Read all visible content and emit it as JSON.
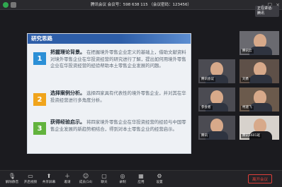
{
  "window": {
    "title": "腾讯会议  会议号：598 638 115 （会议密码：123456）",
    "speaking_label": "正在讲话: 腾讯"
  },
  "share": {
    "label": ""
  },
  "slide": {
    "header": "研究思路",
    "points": [
      {
        "num": "1",
        "title": "把握理论背景。",
        "text": "在把握境外零售企业定义的基础上，借助文献资料对境外零售企业在华投资经营的研究进行了解，提出如何用境外零售企业在华投资经营的经验帮助本土零售企业发展的问题。"
      },
      {
        "num": "2",
        "title": "选择案例分析。",
        "text": "选择四家具有代表性的境外零售企业，并对其在华投资经营进行多角度分析。"
      },
      {
        "num": "3",
        "title": "获得经验启示。",
        "text": "将四家境外零售企业在华投资经营的经验与中国零售企业发展的新趋势相结合，得到对本土零售企业的经营启示。"
      }
    ]
  },
  "participants": [
    {
      "name": "腾讯云"
    },
    {
      "name": "腾讯会议"
    },
    {
      "name": "刘勇"
    },
    {
      "name": "参会者"
    },
    {
      "name": "柯建飞"
    },
    {
      "name": "腾讯"
    },
    {
      "name": "腾讯1601班"
    }
  ],
  "toolbar": {
    "buttons": [
      "解除静音",
      "开启视频",
      "共享屏幕",
      "邀请",
      "成员(14)",
      "聊天",
      "录制",
      "应用",
      "设置"
    ],
    "leave": "离开会议"
  }
}
